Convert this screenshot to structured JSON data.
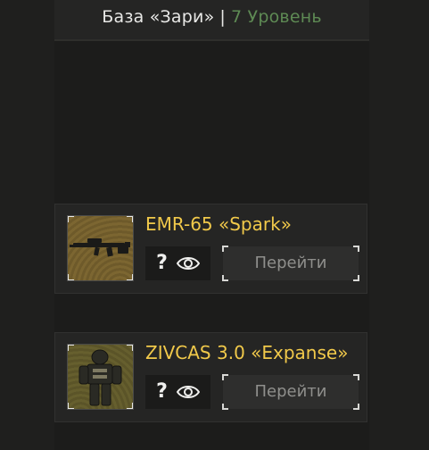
{
  "header": {
    "base_name": "База «Зари»",
    "separator": "|",
    "level": "7 Уровень",
    "level_color": "#5e8a54"
  },
  "items": [
    {
      "title": "EMR-65 «Spark»",
      "thumbnail_icon": "rifle-icon",
      "help_symbol": "?",
      "view_icon": "eye-icon",
      "button_label": "Перейти"
    },
    {
      "title": "ZIVCAS 3.0 «Expanse»",
      "thumbnail_icon": "armor-suit-icon",
      "help_symbol": "?",
      "view_icon": "eye-icon",
      "button_label": "Перейти"
    }
  ],
  "colors": {
    "title": "#f1c94a",
    "background": "#1f1f1e",
    "card": "#252524"
  }
}
